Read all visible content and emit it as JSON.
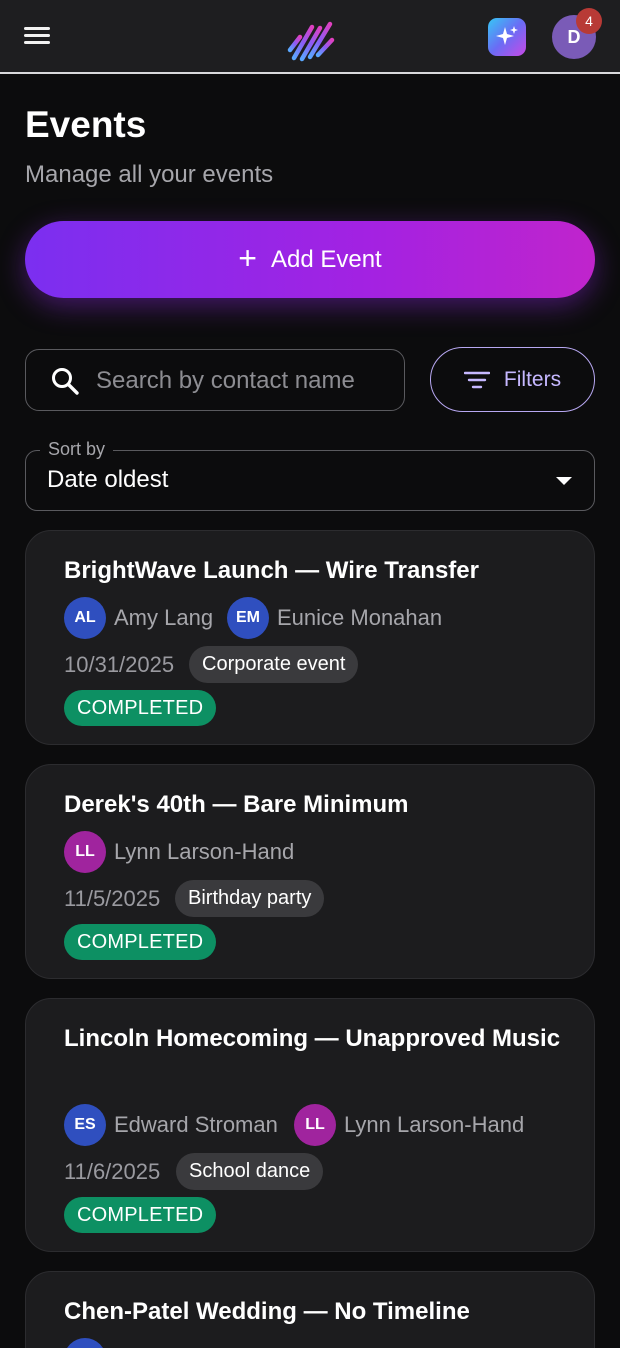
{
  "topbar": {
    "notification_count": "4",
    "user_initial": "D",
    "icons": {
      "menu": "hamburger-menu-icon",
      "logo": "app-logo-icon",
      "ai": "sparkles-icon"
    }
  },
  "header": {
    "title": "Events",
    "subtitle": "Manage all your events",
    "add_button_label": "Add Event"
  },
  "search": {
    "placeholder": "Search by contact name",
    "value": ""
  },
  "filters": {
    "label": "Filters"
  },
  "sort": {
    "label": "Sort by",
    "value": "Date oldest"
  },
  "events": [
    {
      "title": "BrightWave Launch — Wire Transfer",
      "contacts": [
        {
          "initials": "AL",
          "name": "Amy Lang"
        },
        {
          "initials": "EM",
          "name": "Eunice Monahan"
        }
      ],
      "date": "10/31/2025",
      "type": "Corporate event",
      "status": "COMPLETED"
    },
    {
      "title": "Derek's 40th — Bare Minimum",
      "contacts": [
        {
          "initials": "LL",
          "name": "Lynn Larson-Hand"
        }
      ],
      "date": "11/5/2025",
      "type": "Birthday party",
      "status": "COMPLETED"
    },
    {
      "title": "Lincoln Homecoming — Unapproved Music",
      "contacts": [
        {
          "initials": "ES",
          "name": "Edward Stroman"
        },
        {
          "initials": "LL",
          "name": "Lynn Larson-Hand"
        }
      ],
      "date": "11/6/2025",
      "type": "School dance",
      "status": "COMPLETED"
    },
    {
      "title": "Chen-Patel Wedding — No Timeline"
    }
  ],
  "colors": {
    "background": "#0c0c0d",
    "card": "#1c1c1e",
    "accent_start": "#7b2ff0",
    "accent_end": "#c024cc",
    "status_completed": "#0d9063",
    "avatar_blue": "#2f4fbf",
    "avatar_magenta": "#a0249e"
  }
}
